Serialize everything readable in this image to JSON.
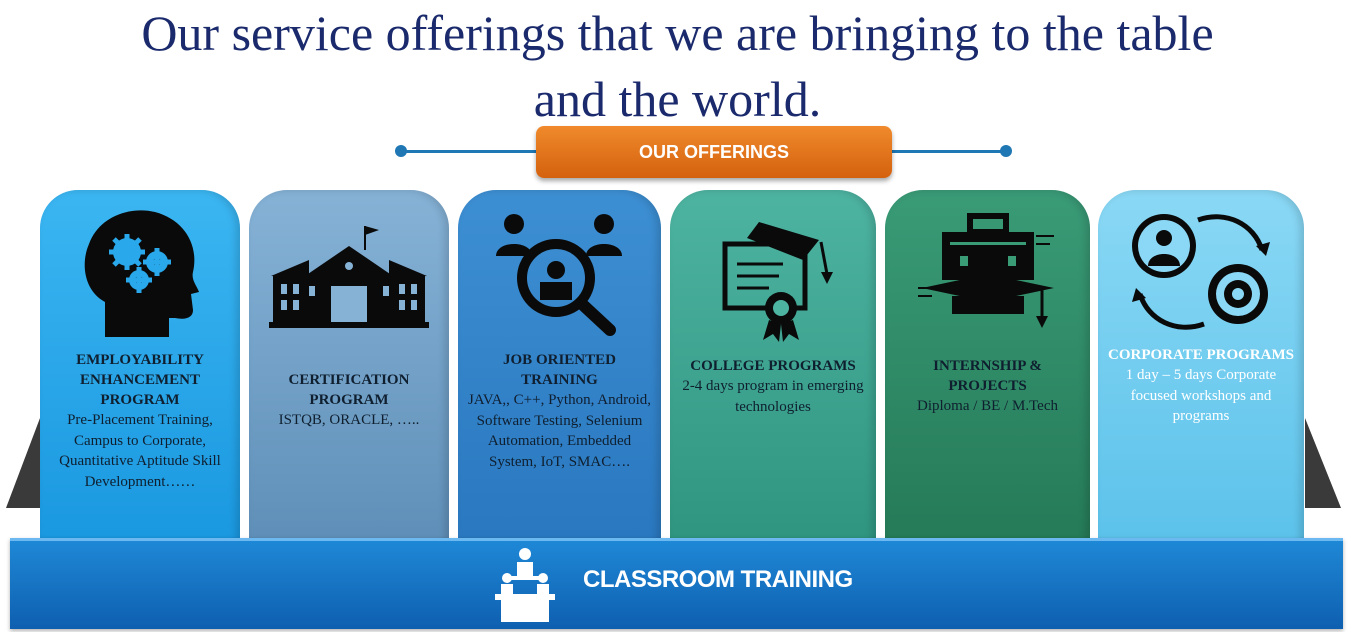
{
  "title": {
    "line1": "Our service offerings that we are bringing to the table",
    "line2": "and the world."
  },
  "offerings_label": "OUR OFFERINGS",
  "cards": [
    {
      "title": "EMPLOYABILITY ENHANCEMENT PROGRAM",
      "description": "Pre-Placement Training, Campus to Corporate, Quantitative Aptitude Skill Development……",
      "icon": "head-gears-icon",
      "color": "#29a8ec"
    },
    {
      "title": "CERTIFICATION PROGRAM",
      "description": "ISTQB, ORACLE, …..",
      "icon": "school-building-icon",
      "color": "#6f9ec4"
    },
    {
      "title": "JOB ORIENTED TRAINING",
      "description": "JAVA,, C++, Python, Android,  Software Testing, Selenium Automation, Embedded System, IoT, SMAC….",
      "icon": "candidate-search-icon",
      "color": "#2e82c9"
    },
    {
      "title": "COLLEGE PROGRAMS",
      "description": "2-4 days program in emerging technologies",
      "icon": "diploma-graduation-icon",
      "color": "#3ea593"
    },
    {
      "title": "INTERNSHIP & PROJECTS",
      "description": "Diploma  / BE / M.Tech",
      "icon": "briefcase-graduation-icon",
      "color": "#2f8f6a"
    },
    {
      "title": "CORPORATE PROGRAMS",
      "description": "1 day – 5 days Corporate focused workshops and programs",
      "icon": "person-cycle-gear-icon",
      "color": "#74cdf0"
    }
  ],
  "base_label": "CLASSROOM TRAINING",
  "base_icon": "classroom-lecture-icon",
  "colors": {
    "title": "#1a2a6c",
    "badge": "#e2731b",
    "base": "#1673c2",
    "connector": "#1f77b4"
  }
}
